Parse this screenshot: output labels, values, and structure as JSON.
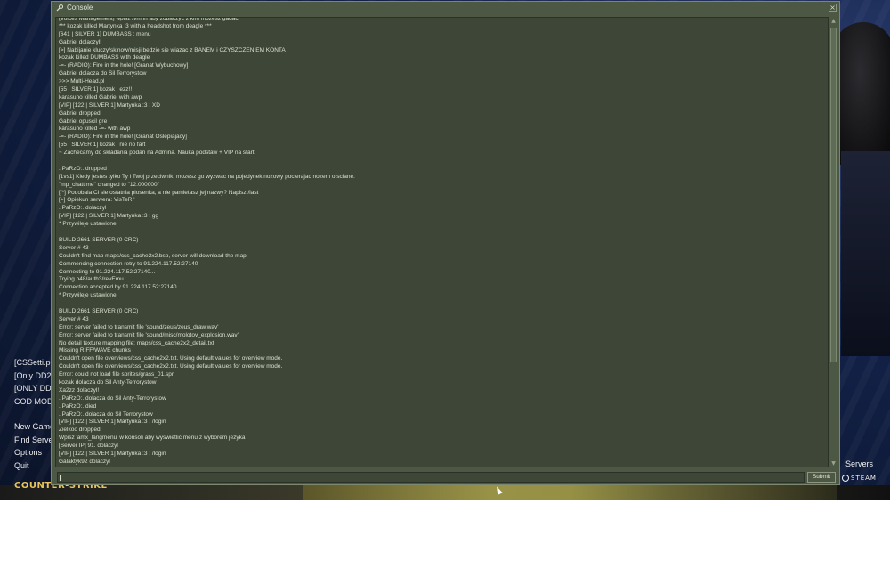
{
  "console": {
    "title": "Console",
    "close_glyph": "×",
    "submit_label": "Submit",
    "input_value": "",
    "scroll_up_glyph": "▲",
    "scroll_down_glyph": "▼",
    "lines": [
      "[Voices Management] wpisz /vm in aby zobaczyc z kim mozesz gadac",
      "*** kozak killed Martynka :3 with a headshot from deagle ***",
      "[641 | SILVER 1] DUMBASS : menu",
      "Gabriel dolaczyl!",
      "[>] Nabijanie kluczy/skinow/misji bedzie sie wiazac z BANEM i CZYSZCZENIEM KONTA",
      "kozak killed DUMBASS with deagle",
      "-=- (RADIO): Fire in the hole! [Granat Wybuchowy]",
      "Gabriel dolacza do Sil Terrorystow",
      ">>> Multi-Head.pl",
      "[55 | SILVER 1] kozak : ezz!!",
      "karasuno killed Gabriel with awp",
      "[VIP] [122 | SILVER 1] Martynka :3 : XD",
      "Gabriel dropped",
      "Gabriel opuscil gre",
      "karasuno killed -=- with awp",
      "-=- (RADIO): Fire in the hole! [Granat Oslepiajacy]",
      "[55 | SILVER 1] kozak : nie no fart",
      "~ Zachecamy do skladania podan na Admina. Nauka podstaw + VIP na start.",
      "",
      ".:PaRzO:. dropped",
      "[1vs1] Kiedy jestes tylko Ty i Twoj przeciwnik, mozesz go wyzwac na pojedynek nozowy pocierajac nozem o sciane.",
      "\"mp_chattime\" changed to \"12.000000\"",
      "[/*] Podobala Ci sie ostatnia piosenka, a nie pamietasz jej nazwy? Napisz /last",
      "[>] Opiekun serwera: VisTeR.'",
      ".:PaRzO:. dolaczyl",
      "[VIP] [122 | SILVER 1] Martynka :3 : gg",
      "* Przywileje ustawione",
      "",
      "BUILD 2661 SERVER (0 CRC)",
      "Server # 43",
      "Couldn't find map maps/css_cache2x2.bsp, server will download the map",
      "Commencing connection retry to 91.224.117.52:27140",
      "Connecting to 91.224.117.52:27140...",
      "Trying p48/auth3/revEmu...",
      "Connection accepted by 91.224.117.52:27140",
      "* Przywileje ustawione",
      "",
      "BUILD 2661 SERVER (0 CRC)",
      "Server # 43",
      "Error: server failed to transmit file 'sound/zeus/zeus_draw.wav'",
      "Error: server failed to transmit file 'sound/misc/molotov_explosion.wav'",
      "No detail texture mapping file: maps/css_cache2x2_detail.txt",
      "Missing RIFF/WAVE chunks",
      "Couldn't open file overviews/css_cache2x2.txt. Using default values for overview mode.",
      "Couldn't open file overviews/css_cache2x2.txt. Using default values for overview mode.",
      "Error: could not load file sprites/grass_01.spr",
      "kozak dolacza do Sil Anty-Terrorystow",
      "Xa2zz dolaczyl!",
      ".:PaRzO:. dolacza do Sil Anty-Terrorystow",
      ".:PaRzO:. died",
      ".:PaRzO:. dolacza do Sil Terrorystow",
      "[VIP] [122 | SILVER 1] Martynka :3 : /login",
      "Zielkoo dropped",
      "Wpisz 'amx_langmenu' w konsoli aby wyswietlic menu z wyborem jezyka",
      "[Server IP] 91. dolaczyl",
      "[VIP] [122 | SILVER 1] Martynka :3 : /login",
      "Galaktyk92 dolaczyl"
    ]
  },
  "background": {
    "servers": [
      "[CSSetti.p",
      "[Only DD2",
      "[ONLY DD",
      "COD MOD"
    ],
    "menu": {
      "new_game": "New Game",
      "find_servers": "Find Serve",
      "options": "Options",
      "quit": "Quit"
    },
    "logo_text": "COUNTER-STRIKE",
    "right_servers": "Servers",
    "steam_label": "STEAM"
  }
}
